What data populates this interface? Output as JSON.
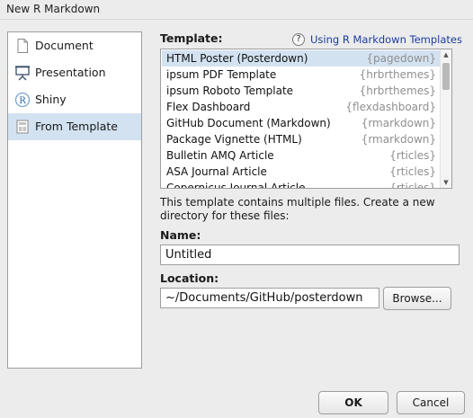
{
  "window": {
    "title": "New R Markdown"
  },
  "sidebar": {
    "items": [
      {
        "label": "Document",
        "icon": "document-icon",
        "selected": false
      },
      {
        "label": "Presentation",
        "icon": "presentation-icon",
        "selected": false
      },
      {
        "label": "Shiny",
        "icon": "shiny-r-icon",
        "selected": false
      },
      {
        "label": "From Template",
        "icon": "template-icon",
        "selected": true
      }
    ]
  },
  "template_section": {
    "label": "Template:",
    "help_link": "Using R Markdown Templates",
    "help_icon_glyph": "?",
    "rows": [
      {
        "name": "HTML Poster (Posterdown)",
        "package": "{pagedown}",
        "selected": true
      },
      {
        "name": "ipsum PDF Template",
        "package": "{hrbrthemes}",
        "selected": false
      },
      {
        "name": "ipsum Roboto Template",
        "package": "{hrbrthemes}",
        "selected": false
      },
      {
        "name": "Flex Dashboard",
        "package": "{flexdashboard}",
        "selected": false
      },
      {
        "name": "GitHub Document (Markdown)",
        "package": "{rmarkdown}",
        "selected": false
      },
      {
        "name": "Package Vignette (HTML)",
        "package": "{rmarkdown}",
        "selected": false
      },
      {
        "name": "Bulletin AMQ Article",
        "package": "{rticles}",
        "selected": false
      },
      {
        "name": "ASA Journal Article",
        "package": "{rticles}",
        "selected": false
      },
      {
        "name": "Copernicus Journal Article",
        "package": "{rticles}",
        "selected": false
      }
    ]
  },
  "description": "This template contains multiple files. Create a new directory for these files:",
  "name_field": {
    "label": "Name:",
    "value": "Untitled"
  },
  "location_field": {
    "label": "Location:",
    "value": "~/Documents/GitHub/posterdown",
    "browse_label": "Browse..."
  },
  "buttons": {
    "ok": "OK",
    "cancel": "Cancel"
  },
  "colors": {
    "selection": "#d3e2f1",
    "link": "#1b3d9c",
    "package_text": "#8f8f8f"
  }
}
